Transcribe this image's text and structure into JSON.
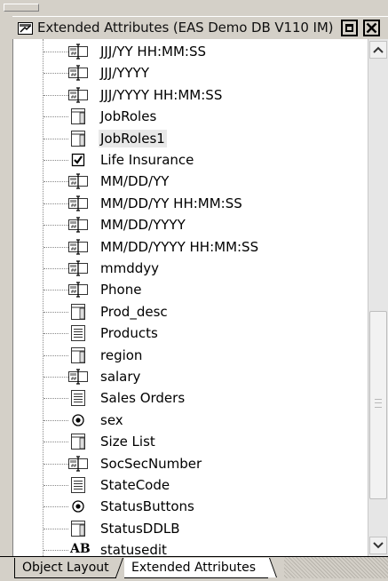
{
  "window": {
    "title": "Extended Attributes (EAS Demo DB V110 IM)"
  },
  "tree": {
    "items": [
      {
        "label": "JJJ/YY HH:MM:SS",
        "icon": "edit-mask-icon"
      },
      {
        "label": "JJJ/YYYY",
        "icon": "edit-mask-icon"
      },
      {
        "label": "JJJ/YYYY HH:MM:SS",
        "icon": "edit-mask-icon"
      },
      {
        "label": "JobRoles",
        "icon": "dropdown-datawindow-icon"
      },
      {
        "label": "JobRoles1",
        "icon": "dropdown-datawindow-icon",
        "selected": true
      },
      {
        "label": "Life Insurance",
        "icon": "checkbox-icon"
      },
      {
        "label": "MM/DD/YY",
        "icon": "edit-mask-icon"
      },
      {
        "label": "MM/DD/YY HH:MM:SS",
        "icon": "edit-mask-icon"
      },
      {
        "label": "MM/DD/YYYY",
        "icon": "edit-mask-icon"
      },
      {
        "label": "MM/DD/YYYY HH:MM:SS",
        "icon": "edit-mask-icon"
      },
      {
        "label": "mmddyy",
        "icon": "edit-mask-icon"
      },
      {
        "label": "Phone",
        "icon": "edit-mask-icon"
      },
      {
        "label": "Prod_desc",
        "icon": "dropdown-datawindow-icon"
      },
      {
        "label": "Products",
        "icon": "dropdown-listbox-icon"
      },
      {
        "label": "region",
        "icon": "dropdown-datawindow-icon"
      },
      {
        "label": "salary",
        "icon": "edit-mask-icon"
      },
      {
        "label": "Sales Orders",
        "icon": "dropdown-listbox-icon"
      },
      {
        "label": "sex",
        "icon": "radio-button-icon"
      },
      {
        "label": "Size List",
        "icon": "dropdown-datawindow-icon"
      },
      {
        "label": "SocSecNumber",
        "icon": "edit-mask-icon"
      },
      {
        "label": "StateCode",
        "icon": "dropdown-listbox-icon"
      },
      {
        "label": "StatusButtons",
        "icon": "radio-button-icon"
      },
      {
        "label": "StatusDDLB",
        "icon": "dropdown-datawindow-icon"
      },
      {
        "label": "statusedit",
        "icon": "edit-text-icon",
        "glyph": "AB"
      }
    ]
  },
  "tabs": {
    "object_layout": "Object Layout",
    "extended_attributes": "Extended Attributes"
  }
}
